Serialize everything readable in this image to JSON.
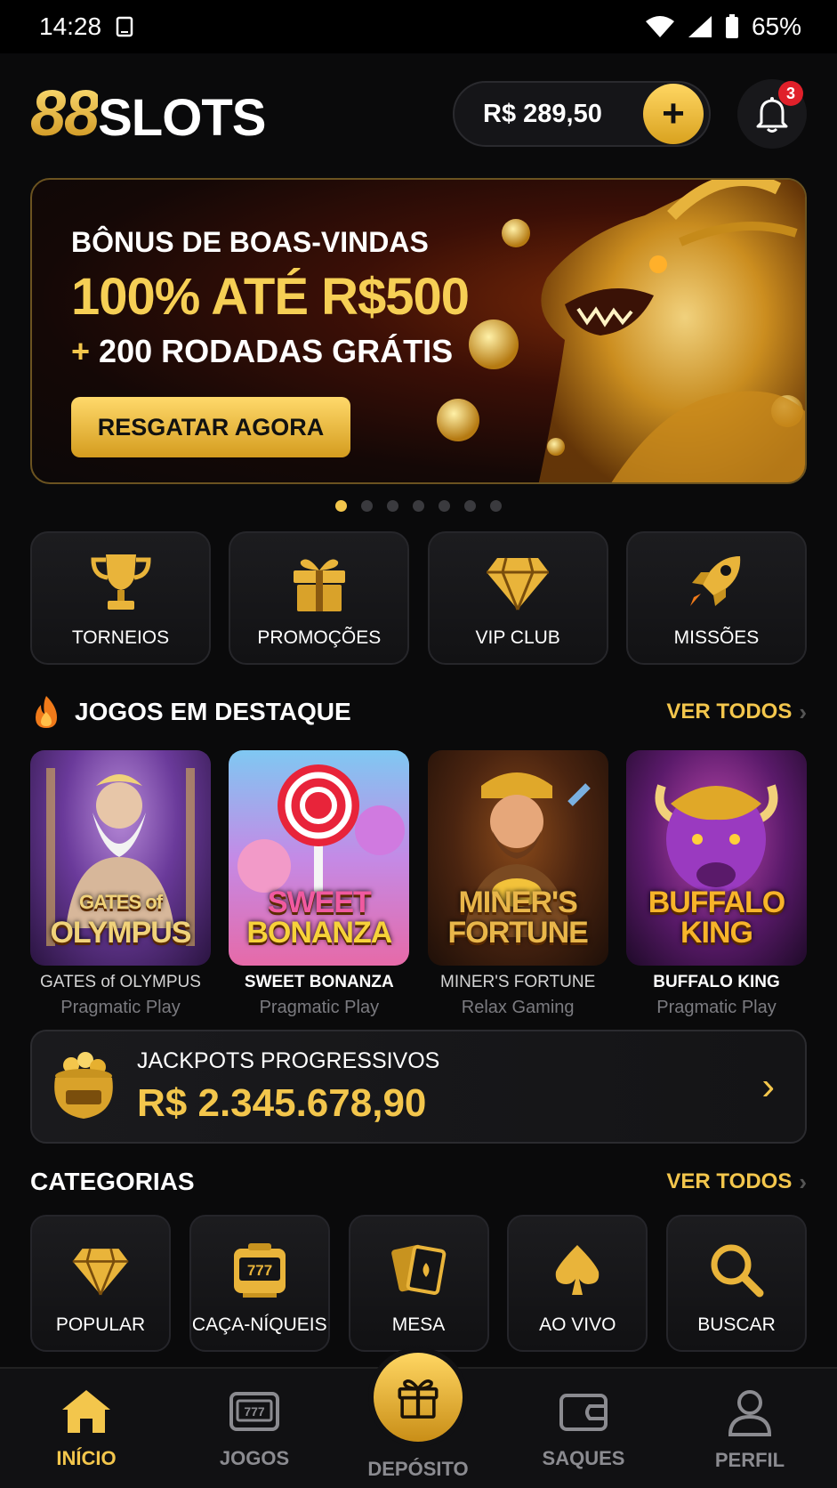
{
  "status_bar": {
    "time": "14:28",
    "battery": "65%"
  },
  "header": {
    "logo_number": "88",
    "logo_text": "SLOTS",
    "balance": "R$ 289,50",
    "add_label": "+",
    "notification_count": "3"
  },
  "banner": {
    "line1": "BÔNUS DE BOAS-VINDAS",
    "line2": "100% ATÉ R$500",
    "line3_prefix": "+",
    "line3": "200 RODADAS GRÁTIS",
    "cta": "RESGATAR AGORA",
    "slide_count": 7,
    "active_slide": 1
  },
  "quick_links": [
    {
      "label": "TORNEIOS",
      "icon": "trophy-icon"
    },
    {
      "label": "PROMOÇÕES",
      "icon": "gift-icon"
    },
    {
      "label": "VIP CLUB",
      "icon": "diamond-icon"
    },
    {
      "label": "MISSÕES",
      "icon": "rocket-icon"
    }
  ],
  "featured": {
    "title": "JOGOS EM DESTAQUE",
    "see_all": "VER TODOS",
    "games": [
      {
        "name": "GATES of OLYMPUS",
        "provider": "Pragmatic Play",
        "art_title_1": "GATES of",
        "art_title_2": "OLYMPUS"
      },
      {
        "name": "SWEET BONANZA",
        "provider": "Pragmatic Play",
        "art_title_1": "SWEET",
        "art_title_2": "BONANZA"
      },
      {
        "name": "MINER'S FORTUNE",
        "provider": "Relax Gaming",
        "art_title_1": "MINER'S",
        "art_title_2": "FORTUNE"
      },
      {
        "name": "BUFFALO KING",
        "provider": "Pragmatic Play",
        "art_title_1": "BUFFALO",
        "art_title_2": "KING"
      }
    ]
  },
  "jackpot": {
    "label": "JACKPOTS PROGRESSIVOS",
    "amount": "R$ 2.345.678,90"
  },
  "categories": {
    "title": "CATEGORIAS",
    "see_all": "VER TODOS",
    "items": [
      {
        "label": "POPULAR",
        "icon": "diamond-icon"
      },
      {
        "label": "CAÇA-NÍQUEIS",
        "icon": "slot-machine-icon"
      },
      {
        "label": "MESA",
        "icon": "cards-icon"
      },
      {
        "label": "AO VIVO",
        "icon": "spade-icon"
      },
      {
        "label": "BUSCAR",
        "icon": "search-icon"
      }
    ]
  },
  "bottom_nav": [
    {
      "label": "INÍCIO",
      "icon": "home-icon",
      "active": true
    },
    {
      "label": "JOGOS",
      "icon": "slot-icon"
    },
    {
      "label": "DEPÓSITO",
      "icon": "gift-icon"
    },
    {
      "label": "SAQUES",
      "icon": "wallet-icon"
    },
    {
      "label": "PERFIL",
      "icon": "user-icon"
    }
  ],
  "colors": {
    "accent": "#f3c64c",
    "background": "#0a0a0b",
    "badge": "#e0202a"
  }
}
